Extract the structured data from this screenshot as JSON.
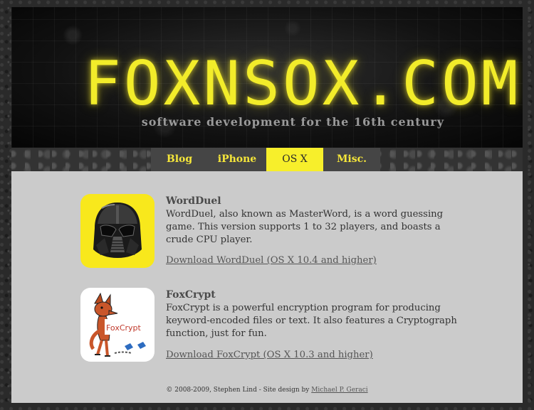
{
  "header": {
    "logo_text": "FOXNSOX.COM",
    "tagline": "software development for the 16th century"
  },
  "nav": {
    "tabs": [
      {
        "label": "Blog",
        "active": false
      },
      {
        "label": "iPhone",
        "active": false
      },
      {
        "label": "OS X",
        "active": true
      },
      {
        "label": "Misc.",
        "active": false
      }
    ]
  },
  "apps": [
    {
      "title": "WordDuel",
      "description": "WordDuel, also known as MasterWord, is a word guessing game. This version supports 1 to 32 players, and boasts a crude CPU player.",
      "download_label": "Download WordDuel (OS X 10.4 and higher)",
      "icon": "darth-vader-helmet-icon"
    },
    {
      "title": "FoxCrypt",
      "description": "FoxCrypt is a powerful encryption program for producing keyword-encoded files or text. It also features a Cryptograph function, just for fun.",
      "download_label": "Download FoxCrypt (OS X 10.3 and higher)",
      "icon": "fox-illustration-icon",
      "icon_text": "FoxCrypt"
    }
  ],
  "footer": {
    "text": "© 2008-2009, Stephen Lind - Site design by ",
    "designer": "Michael P. Geraci"
  },
  "colors": {
    "accent_yellow": "#f7ef2b",
    "nav_bg": "#454545",
    "content_bg": "#cbcbcb",
    "icon_yellow_bg": "#f8e81c"
  }
}
